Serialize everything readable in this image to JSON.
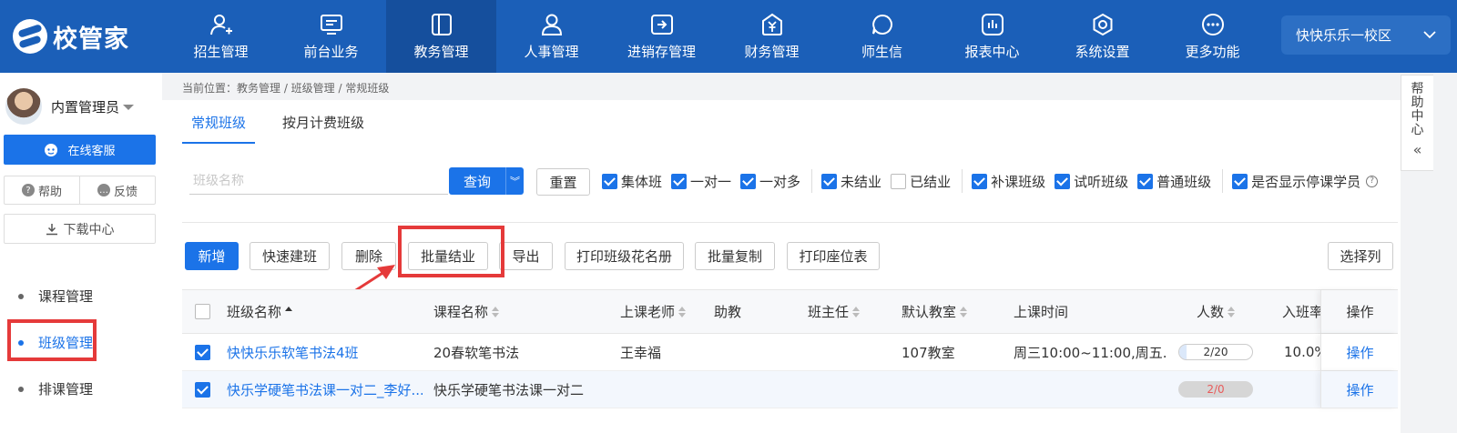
{
  "topbar": {
    "logo_text": "校管家",
    "nav": [
      {
        "label": "招生管理",
        "icon": "person-plus-icon"
      },
      {
        "label": "前台业务",
        "icon": "monitor-icon"
      },
      {
        "label": "教务管理",
        "icon": "book-icon",
        "active": true
      },
      {
        "label": "人事管理",
        "icon": "person-icon"
      },
      {
        "label": "进销存管理",
        "icon": "inventory-icon"
      },
      {
        "label": "财务管理",
        "icon": "money-bag-icon"
      },
      {
        "label": "师生信",
        "icon": "chat-icon"
      },
      {
        "label": "报表中心",
        "icon": "bar-chart-icon"
      },
      {
        "label": "系统设置",
        "icon": "gear-icon"
      },
      {
        "label": "更多功能",
        "icon": "more-icon"
      }
    ],
    "campus": "快快乐乐一校区"
  },
  "sidebar": {
    "user_name": "内置管理员",
    "service_label": "在线客服",
    "help_label": "帮助",
    "feedback_label": "反馈",
    "download_label": "下载中心",
    "menu": [
      {
        "label": "课程管理"
      },
      {
        "label": "班级管理",
        "active": true
      },
      {
        "label": "排课管理"
      }
    ]
  },
  "breadcrumb": "当前位置：教务管理 / 班级管理 / 常规班级",
  "tabs": [
    {
      "label": "常规班级",
      "active": true
    },
    {
      "label": "按月计费班级"
    }
  ],
  "filter": {
    "search_placeholder": "班级名称",
    "query_label": "查询",
    "reset_label": "重置",
    "checks": [
      {
        "label": "集体班",
        "checked": true
      },
      {
        "label": "一对一",
        "checked": true
      },
      {
        "label": "一对多",
        "checked": true
      },
      {
        "label": "未结业",
        "checked": true,
        "group_start": true
      },
      {
        "label": "已结业",
        "checked": false
      },
      {
        "label": "补课班级",
        "checked": true,
        "group_start": true
      },
      {
        "label": "试听班级",
        "checked": true
      },
      {
        "label": "普通班级",
        "checked": true
      },
      {
        "label": "是否显示停课学员",
        "checked": true,
        "group_start": true,
        "help": true
      }
    ]
  },
  "toolbar": {
    "add": "新增",
    "quick_build": "快速建班",
    "delete": "删除",
    "batch_graduate": "批量结业",
    "export": "导出",
    "print_roster": "打印班级花名册",
    "batch_copy": "批量复制",
    "print_seating": "打印座位表",
    "select_columns": "选择列"
  },
  "table": {
    "headers": {
      "class_name": "班级名称",
      "course_name": "课程名称",
      "teacher": "上课老师",
      "assistant": "助教",
      "head_teacher": "班主任",
      "classroom": "默认教室",
      "schedule": "上课时间",
      "count": "人数",
      "rate": "入班率",
      "action": "操作"
    },
    "rows": [
      {
        "checked": true,
        "class_name": "快快乐乐软笔书法4班",
        "course_name": "20春软笔书法",
        "teacher": "王幸福",
        "assistant": "",
        "head_teacher": "",
        "classroom": "107教室",
        "schedule": "周三10:00~11:00,周五...",
        "count": "2/20",
        "fill": 0.1,
        "rate": "10.0%",
        "action": "操作"
      },
      {
        "checked": true,
        "class_name": "快乐学硬笔书法课一对二_李好...",
        "course_name": "快乐学硬笔书法课一对二",
        "teacher": "",
        "assistant": "",
        "head_teacher": "",
        "classroom": "",
        "schedule": "",
        "count": "2/0",
        "full": true,
        "rate": "",
        "action": "操作"
      }
    ]
  },
  "help_tab": {
    "text": "帮助中心"
  },
  "colors": {
    "brand": "#1b5fb8",
    "accent": "#1b73e8",
    "annotation": "#e53a3a"
  }
}
